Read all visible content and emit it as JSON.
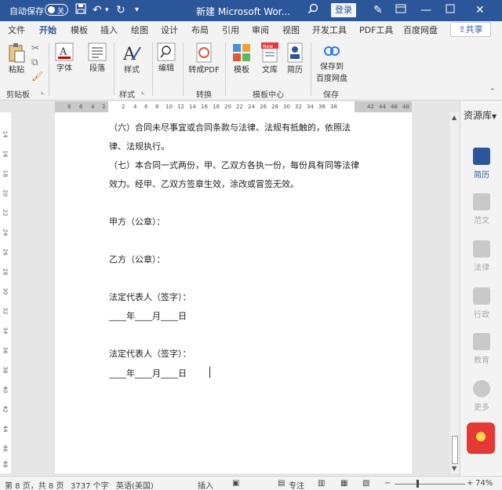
{
  "titlebar": {
    "autosave_label": "自动保存",
    "autosave_state": "关",
    "doc_title": "新建 Microsoft Wor...",
    "login_label": "登录"
  },
  "tabs": [
    "文件",
    "开始",
    "模板",
    "插入",
    "绘图",
    "设计",
    "布局",
    "引用",
    "审阅",
    "视图",
    "开发工具",
    "PDF工具",
    "百度网盘"
  ],
  "share_label": "共享",
  "ribbon": {
    "paste": "粘贴",
    "clipboard_group": "剪贴板",
    "font": "字体",
    "paragraph": "段落",
    "styles": "样式",
    "styles_group": "样式",
    "edit": "编辑",
    "to_pdf": "转成PDF",
    "convert_group": "转换",
    "template": "模板",
    "library": "文库",
    "resume": "简历",
    "template_center_group": "模板中心",
    "save_to_baidu_line1": "保存到",
    "save_to_baidu_line2": "百度网盘",
    "save_group": "保存",
    "new_badge": "New"
  },
  "ruler": {
    "h_ticks": [
      "8",
      "6",
      "4",
      "2",
      "",
      "2",
      "4",
      "6",
      "8",
      "10",
      "12",
      "14",
      "16",
      "18",
      "20",
      "22",
      "24",
      "26",
      "28",
      "30",
      "32",
      "34",
      "36",
      "38",
      "",
      "42",
      "44",
      "46",
      "48"
    ],
    "v_ticks": [
      "14",
      "16",
      "18",
      "20",
      "22",
      "24",
      "26",
      "28",
      "30",
      "32",
      "34",
      "36",
      "38",
      "40",
      "42",
      "44",
      "46",
      "48"
    ]
  },
  "document": {
    "lines": [
      "（六）合同未尽事宜或合同条款与法律、法规有抵触的，依照法",
      "律、法规执行。",
      "（七）本合同一式两份，甲、乙双方各执一份，每份具有同等法律",
      "效力。经甲、乙双方签章生效，涂改或冒签无效。",
      "甲方（公章）：",
      "乙方（公章）：",
      "法定代表人（签字）：",
      "____年____月____日",
      "法定代表人（签字）：",
      "____年____月____日"
    ]
  },
  "sidepanel": {
    "title": "资源库",
    "items": [
      "简历",
      "范文",
      "法律",
      "行政",
      "教育",
      "更多"
    ]
  },
  "statusbar": {
    "page": "第 8 页，共 8 页",
    "words": "3737 个字",
    "language": "英语(美国)",
    "mode": "插入",
    "focus": "专注",
    "zoom": "74%"
  }
}
